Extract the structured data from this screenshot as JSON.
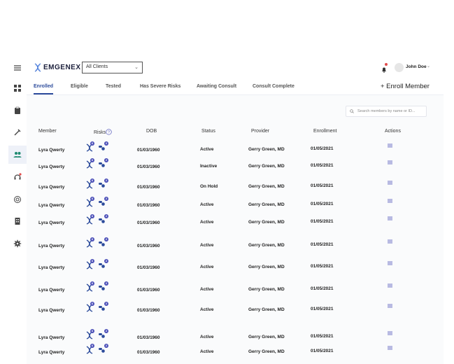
{
  "header": {
    "logo_text": "EMGENEX",
    "client_select": "All Clients",
    "user_name": "John Doe"
  },
  "tabs": [
    {
      "label": "Enrolled",
      "active": true
    },
    {
      "label": "Eligible"
    },
    {
      "label": "Tested"
    },
    {
      "label": "Has Severe Risks"
    },
    {
      "label": "Awaiting Consult"
    },
    {
      "label": "Consult Complete"
    }
  ],
  "enroll_button": "+ Enroll Member",
  "search": {
    "placeholder": "Search members by name or ID..."
  },
  "table": {
    "headers": {
      "member": "Member",
      "risks": "Risks",
      "dob": "DOB",
      "status": "Status",
      "provider": "Provider",
      "enrollment": "Enrollment",
      "actions": "Actions"
    },
    "rows": [
      {
        "member": "Lyra Qwerty",
        "dob": "01/03/1960",
        "status": "Active",
        "provider": "Gerry Green, MD",
        "enrollment": "01/05/2021",
        "dna_count": "6",
        "pill_count": "2"
      },
      {
        "member": "Lyra Qwerty",
        "dob": "01/03/1960",
        "status": "Inactive",
        "provider": "Gerry Green, MD",
        "enrollment": "01/05/2021",
        "dna_count": "6",
        "pill_count": "2"
      },
      {
        "member": "Lyra Qwerty",
        "dob": "01/03/1960",
        "status": "On Hold",
        "provider": "Gerry Green, MD",
        "enrollment": "01/05/2021",
        "dna_count": "6",
        "pill_count": "2"
      },
      {
        "member": "Lyra Qwerty",
        "dob": "01/03/1960",
        "status": "Active",
        "provider": "Gerry Green, MD",
        "enrollment": "01/05/2021",
        "dna_count": "6",
        "pill_count": "2"
      },
      {
        "member": "Lyra Qwerty",
        "dob": "01/03/1960",
        "status": "Active",
        "provider": "Gerry Green, MD",
        "enrollment": "01/05/2021",
        "dna_count": "6",
        "pill_count": "2"
      },
      {
        "member": "Lyra Qwerty",
        "dob": "01/03/1960",
        "status": "Active",
        "provider": "Gerry Green, MD",
        "enrollment": "01/05/2021",
        "dna_count": "6",
        "pill_count": "2"
      },
      {
        "member": "Lyra Qwerty",
        "dob": "01/03/1960",
        "status": "Active",
        "provider": "Gerry Green, MD",
        "enrollment": "01/05/2021",
        "dna_count": "6",
        "pill_count": "2"
      },
      {
        "member": "Lyra Qwerty",
        "dob": "01/03/1960",
        "status": "Active",
        "provider": "Gerry Green, MD",
        "enrollment": "01/05/2021",
        "dna_count": "6",
        "pill_count": "2"
      },
      {
        "member": "Lyra Qwerty",
        "dob": "01/03/1960",
        "status": "Active",
        "provider": "Gerry Green, MD",
        "enrollment": "01/05/2021",
        "dna_count": "6",
        "pill_count": "2"
      },
      {
        "member": "Lyra Qwerty",
        "dob": "01/03/1960",
        "status": "Active",
        "provider": "Gerry Green, MD",
        "enrollment": "01/05/2021",
        "dna_count": "6",
        "pill_count": "2"
      },
      {
        "member": "Lyra Qwerty",
        "dob": "01/03/1960",
        "status": "Active",
        "provider": "Gerry Green, MD",
        "enrollment": "01/05/2021",
        "dna_count": "6",
        "pill_count": "2"
      }
    ]
  },
  "colors": {
    "accent": "#2c4b9b",
    "badge": "#4b4fb8",
    "alert": "#e14b4b"
  }
}
